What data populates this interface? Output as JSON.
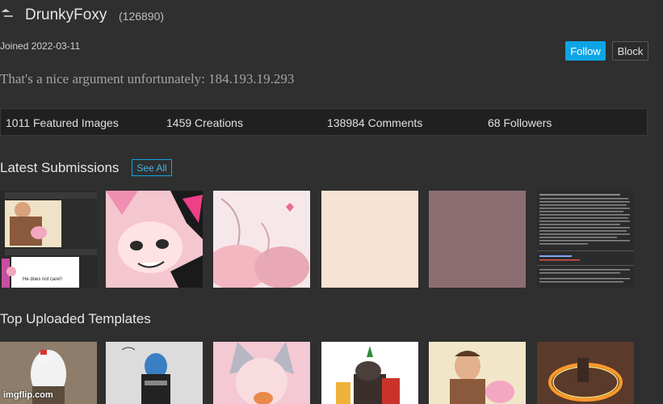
{
  "profile": {
    "username": "DrunkyFoxy",
    "user_id": "(126890)",
    "joined": "Joined 2022-03-11",
    "bio": "That's a nice argument unfortunately: 184.193.19.293",
    "follow_label": "Follow",
    "block_label": "Block"
  },
  "stats": {
    "featured": "1011 Featured Images",
    "creations": "1459 Creations",
    "comments": "138984 Comments",
    "followers": "68 Followers"
  },
  "sections": {
    "latest_title": "Latest Submissions",
    "see_all": "See All",
    "templates_title": "Top Uploaded Templates"
  },
  "thumb1": {
    "caption": "He does not care!!"
  },
  "watermark": "imgflip.com",
  "colors": {
    "accent": "#0ea5e6",
    "background": "#2f2f2f",
    "stats_bar": "#202020",
    "thumb_peach": "#f7e3d2",
    "thumb_mauve": "#8c6e72"
  }
}
